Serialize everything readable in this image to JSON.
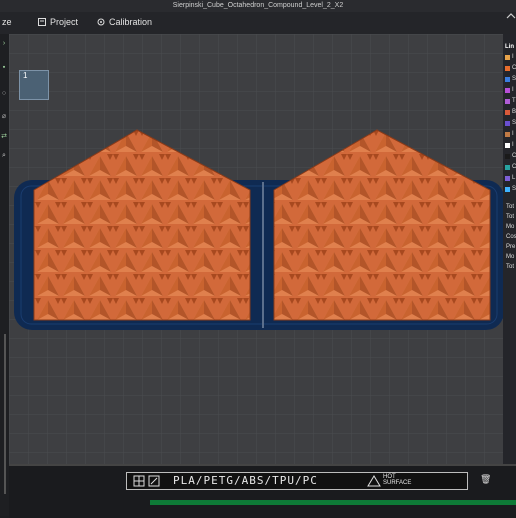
{
  "window": {
    "title": "Sierpinski_Cube_Octahedron_Compound_Level_2_X2"
  },
  "menu": {
    "partial_item": "ze",
    "project_label": "Project",
    "calibration_label": "Calibration"
  },
  "plate": {
    "thumbnail_number": "1",
    "filament_label": "PLA/PETG/ABS/TPU/PC",
    "hot_surface_label": "HOT\nSURFACE"
  },
  "right_panel": {
    "header": "Lin",
    "legend_colors": [
      "#e7a34a",
      "#e86d2c",
      "#3a7de0",
      "#b84fd8",
      "#b05cd6",
      "#d95a3a",
      "#6a4fd0",
      "#c07a45",
      "#ffffff",
      "#1a1a1a",
      "#27a3a0",
      "#7d5fd8",
      "#3fb4ff",
      "#e8d63a",
      "#cfcfcf"
    ],
    "legend_letters": [
      "I",
      "C",
      "S",
      "I",
      "T",
      "B",
      "S",
      "I",
      "I",
      "C",
      "C",
      "L",
      "S"
    ],
    "stats": [
      "Tot",
      "Tot",
      "Mo",
      "Cos",
      "Pre",
      "Mo",
      "Tot"
    ]
  },
  "colors": {
    "model": "#d2693a",
    "bed": "#0f2a52",
    "background": "#3e3f42",
    "accent": "#19a04a"
  }
}
